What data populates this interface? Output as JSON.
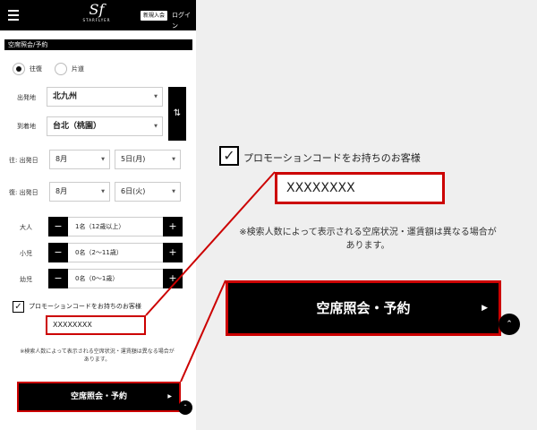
{
  "header": {
    "logo_mark": "Sf",
    "logo_word": "STARFLYER",
    "signup_label": "新規入会",
    "login_label": "ログイン"
  },
  "section_title": "空席照会/予約",
  "trip_type": {
    "options": [
      "往復",
      "片道"
    ],
    "selected": "往復"
  },
  "route": {
    "departure_label": "出発地",
    "departure_value": "北九州",
    "arrival_label": "到着地",
    "arrival_value": "台北（桃園）"
  },
  "dates": {
    "outbound_label": "往: 出発日",
    "outbound_month": "8月",
    "outbound_day": "5日(月)",
    "return_label": "復: 出発日",
    "return_month": "8月",
    "return_day": "6日(火)"
  },
  "passengers": [
    {
      "label": "大人",
      "value": "1名（12歳以上）"
    },
    {
      "label": "小児",
      "value": "0名（2〜11歳）"
    },
    {
      "label": "幼児",
      "value": "0名（0〜1歳）"
    }
  ],
  "promo": {
    "label": "プロモーションコードをお持ちのお客様",
    "value": "XXXXXXXX",
    "checked": true
  },
  "note": "※検索人数によって表示される空席状況・運賃額は異なる場合があります。",
  "note_zoom_line1": "※検索人数によって表示される空席状況・運賃額は異なる場合が",
  "note_zoom_line2": "あります。",
  "note_small_line1": "※検索人数によって表示される空席状況・運賃額は異なる場合が",
  "note_small_line2": "あります。",
  "search_button_label": "空席照会・予約",
  "icons": {
    "menu": "hamburger-icon",
    "swap": "swap-vertical-icon",
    "checkbox": "check-icon",
    "caret": "chevron-down-icon",
    "arrow": "chevron-right-icon",
    "scroll_top": "chevron-up-icon"
  },
  "colors": {
    "highlight": "#cc0000",
    "primary": "#000000"
  }
}
